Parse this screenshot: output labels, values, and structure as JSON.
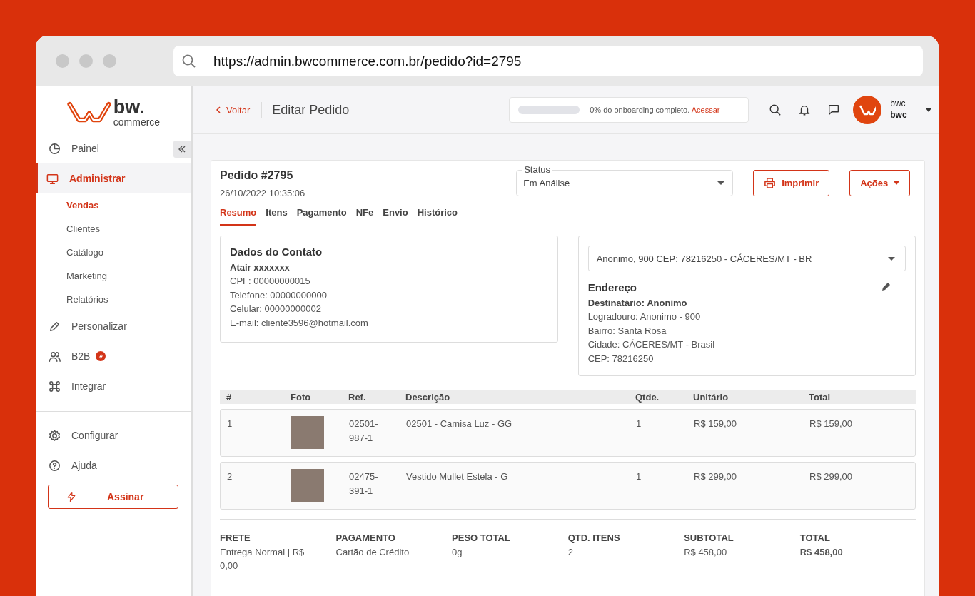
{
  "browser": {
    "url": "https://admin.bwcommerce.com.br/pedido?id=2795"
  },
  "sidebar": {
    "logo": {
      "brand": "bw.",
      "tagline": "commerce"
    },
    "items": [
      {
        "label": "Painel",
        "selected": false
      },
      {
        "label": "Administrar",
        "selected": true,
        "children": [
          {
            "label": "Vendas",
            "selected": true
          },
          {
            "label": "Clientes",
            "selected": false
          },
          {
            "label": "Catálogo",
            "selected": false
          },
          {
            "label": "Marketing",
            "selected": false
          },
          {
            "label": "Relatórios",
            "selected": false
          }
        ]
      },
      {
        "label": "Personalizar",
        "selected": false
      },
      {
        "label": "B2B",
        "selected": false,
        "badge": true
      },
      {
        "label": "Integrar",
        "selected": false
      }
    ],
    "bottom_items": [
      {
        "label": "Configurar",
        "selected": false
      },
      {
        "label": "Ajuda",
        "selected": false
      }
    ],
    "subscribe_button": "Assinar"
  },
  "topbar": {
    "back": "Voltar",
    "title": "Editar Pedido",
    "onboarding": {
      "level": 0,
      "text": "0% do onboarding completo.",
      "link": "Acessar"
    },
    "user": {
      "name": "bwc",
      "store": "bwc"
    }
  },
  "order": {
    "title": "Pedido #2795",
    "date": "26/10/2022 10:35:06",
    "status": {
      "label": "Status",
      "value": "Em Análise"
    },
    "buttons": {
      "print": "Imprimir",
      "actions": "Ações"
    },
    "tabs": [
      {
        "label": "Resumo",
        "selected": true
      },
      {
        "label": "Itens",
        "selected": false
      },
      {
        "label": "Pagamento",
        "selected": false
      },
      {
        "label": "NFe",
        "selected": false
      },
      {
        "label": "Envio",
        "selected": false
      },
      {
        "label": "Histórico",
        "selected": false
      }
    ],
    "contact": {
      "title": "Dados do Contato",
      "name": "Atair xxxxxxx",
      "lines": [
        "CPF: 00000000015",
        "Telefone: 00000000000",
        "Celular: 00000000002",
        "E-mail: cliente3596@hotmail.com"
      ]
    },
    "address": {
      "select": "Anonimo, 900 CEP: 78216250 - CÁCERES/MT - BR",
      "title": "Endereço",
      "recipient": "Destinatário: Anonimo",
      "lines": [
        "Logradouro: Anonimo - 900",
        "Bairro: Santa Rosa",
        "Cidade: CÁCERES/MT - Brasil",
        "CEP: 78216250"
      ]
    },
    "table": {
      "columns": [
        "#",
        "Foto",
        "Ref.",
        "Descrição",
        "Qtde.",
        "Unitário",
        "Total"
      ],
      "rows": [
        [
          "1",
          null,
          "02501-987-1",
          "02501 - Camisa Luz - GG",
          "1",
          "R$ 159,00",
          "R$ 159,00"
        ],
        [
          "2",
          null,
          "02475-391-1",
          "Vestido Mullet Estela - G",
          "1",
          "R$ 299,00",
          "R$ 299,00"
        ]
      ]
    },
    "summary": [
      {
        "label": "FRETE",
        "value": "Entrega Normal | R$ 0,00",
        "emphasis": false
      },
      {
        "label": "PAGAMENTO",
        "value": "Cartão de Crédito",
        "emphasis": false
      },
      {
        "label": "PESO TOTAL",
        "value": "0g",
        "emphasis": false
      },
      {
        "label": "QTD. ITENS",
        "value": "2",
        "emphasis": false
      },
      {
        "label": "SUBTOTAL",
        "value": "R$ 458,00",
        "emphasis": false
      },
      {
        "label": "TOTAL",
        "value": "R$ 458,00",
        "emphasis": true
      }
    ]
  }
}
